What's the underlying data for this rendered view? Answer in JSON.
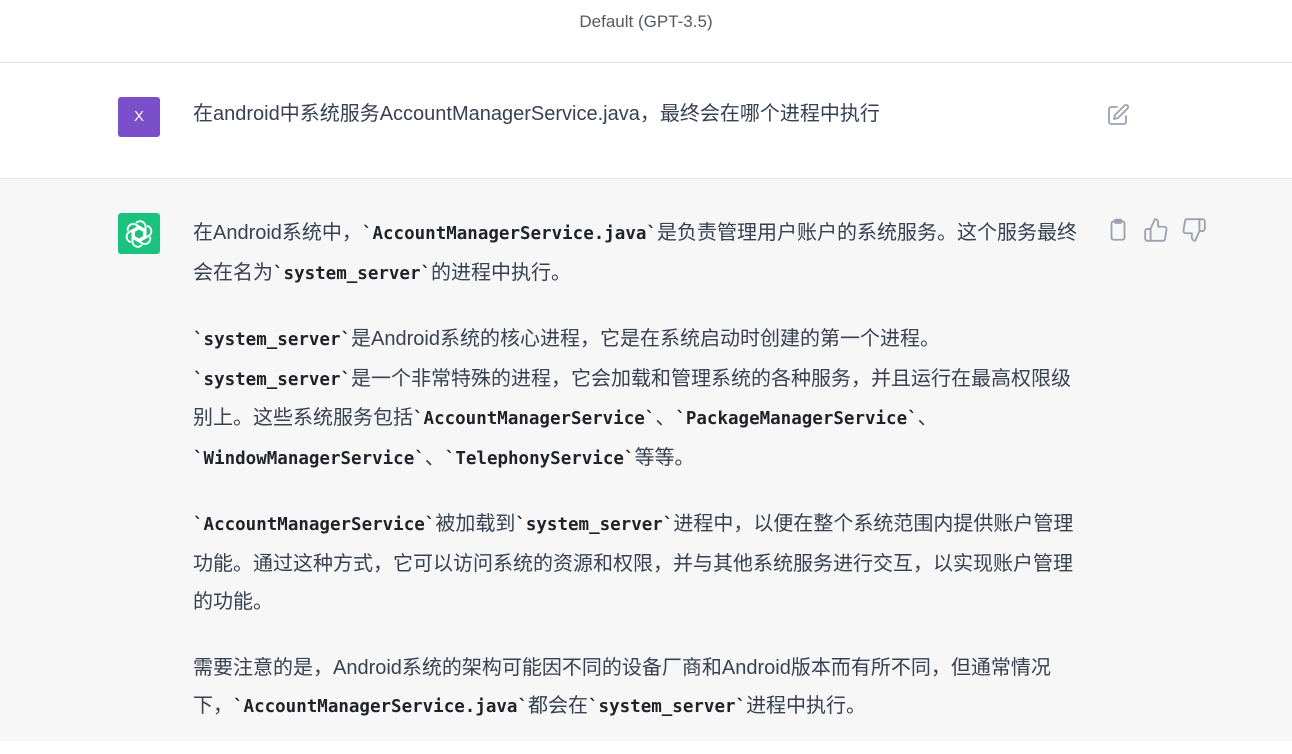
{
  "header": {
    "model": "Default (GPT-3.5)"
  },
  "user_message": {
    "avatar_initial": "X",
    "text": "在android中系统服务AccountManagerService.java，最终会在哪个进程中执行"
  },
  "assistant_message": {
    "paragraphs": [
      [
        {
          "t": "在Android系统中，"
        },
        {
          "t": "`AccountManagerService.java`",
          "code": true
        },
        {
          "t": "是负责管理用户账户的系统服务。这个服务最终会在名为"
        },
        {
          "t": "`system_server`",
          "code": true
        },
        {
          "t": "的进程中执行。"
        }
      ],
      [
        {
          "t": "`system_server`",
          "code": true
        },
        {
          "t": "是Android系统的核心进程，它是在系统启动时创建的第一个进程。"
        },
        {
          "t": "`system_server`",
          "code": true
        },
        {
          "t": "是一个非常特殊的进程，它会加载和管理系统的各种服务，并且运行在最高权限级别上。这些系统服务包括"
        },
        {
          "t": "`AccountManagerService`",
          "code": true
        },
        {
          "t": "、"
        },
        {
          "t": "`PackageManagerService`",
          "code": true
        },
        {
          "t": "、"
        },
        {
          "t": "`WindowManagerService`",
          "code": true
        },
        {
          "t": "、"
        },
        {
          "t": "`TelephonyService`",
          "code": true
        },
        {
          "t": "等等。"
        }
      ],
      [
        {
          "t": "`AccountManagerService`",
          "code": true
        },
        {
          "t": "被加载到"
        },
        {
          "t": "`system_server`",
          "code": true
        },
        {
          "t": "进程中，以便在整个系统范围内提供账户管理功能。通过这种方式，它可以访问系统的资源和权限，并与其他系统服务进行交互，以实现账户管理的功能。"
        }
      ],
      [
        {
          "t": "需要注意的是，Android系统的架构可能因不同的设备厂商和Android版本而有所不同，但通常情况下，"
        },
        {
          "t": "`AccountManagerService.java`",
          "code": true
        },
        {
          "t": "都会在"
        },
        {
          "t": "`system_server`",
          "code": true
        },
        {
          "t": "进程中执行。"
        }
      ]
    ],
    "actions": [
      {
        "name": "copy-icon"
      },
      {
        "name": "thumbs-up-icon"
      },
      {
        "name": "thumbs-down-icon"
      }
    ]
  },
  "colors": {
    "user_avatar": "#7b4fc9",
    "assistant_avatar": "#19c37d",
    "assistant_background": "#f7f7f8"
  }
}
